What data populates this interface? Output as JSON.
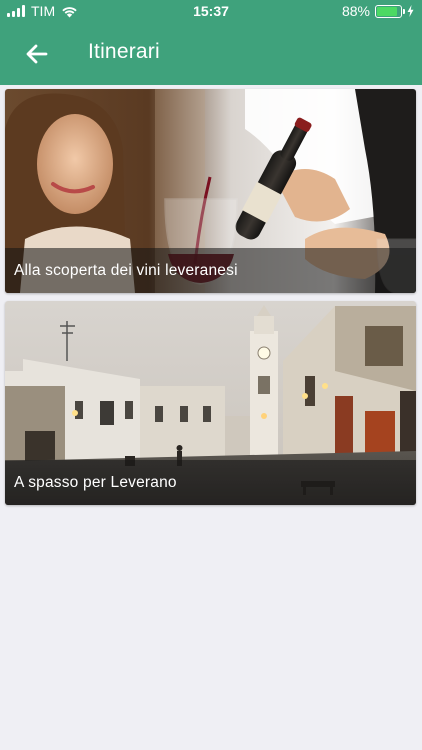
{
  "status_bar": {
    "carrier": "TIM",
    "time": "15:37",
    "battery_percent": "88%",
    "battery_level": 0.88,
    "icons": [
      "signal-icon",
      "wifi-icon",
      "battery-icon",
      "charging-bolt-icon"
    ]
  },
  "app_bar": {
    "title": "Itinerari",
    "back_icon": "arrow-left-icon",
    "background_color": "#3fa27c"
  },
  "itineraries": [
    {
      "title": "Alla scoperta dei vini leveranesi",
      "image": "wine-pouring-photo"
    },
    {
      "title": "A spasso per Leverano",
      "image": "town-square-clock-tower-photo"
    }
  ]
}
